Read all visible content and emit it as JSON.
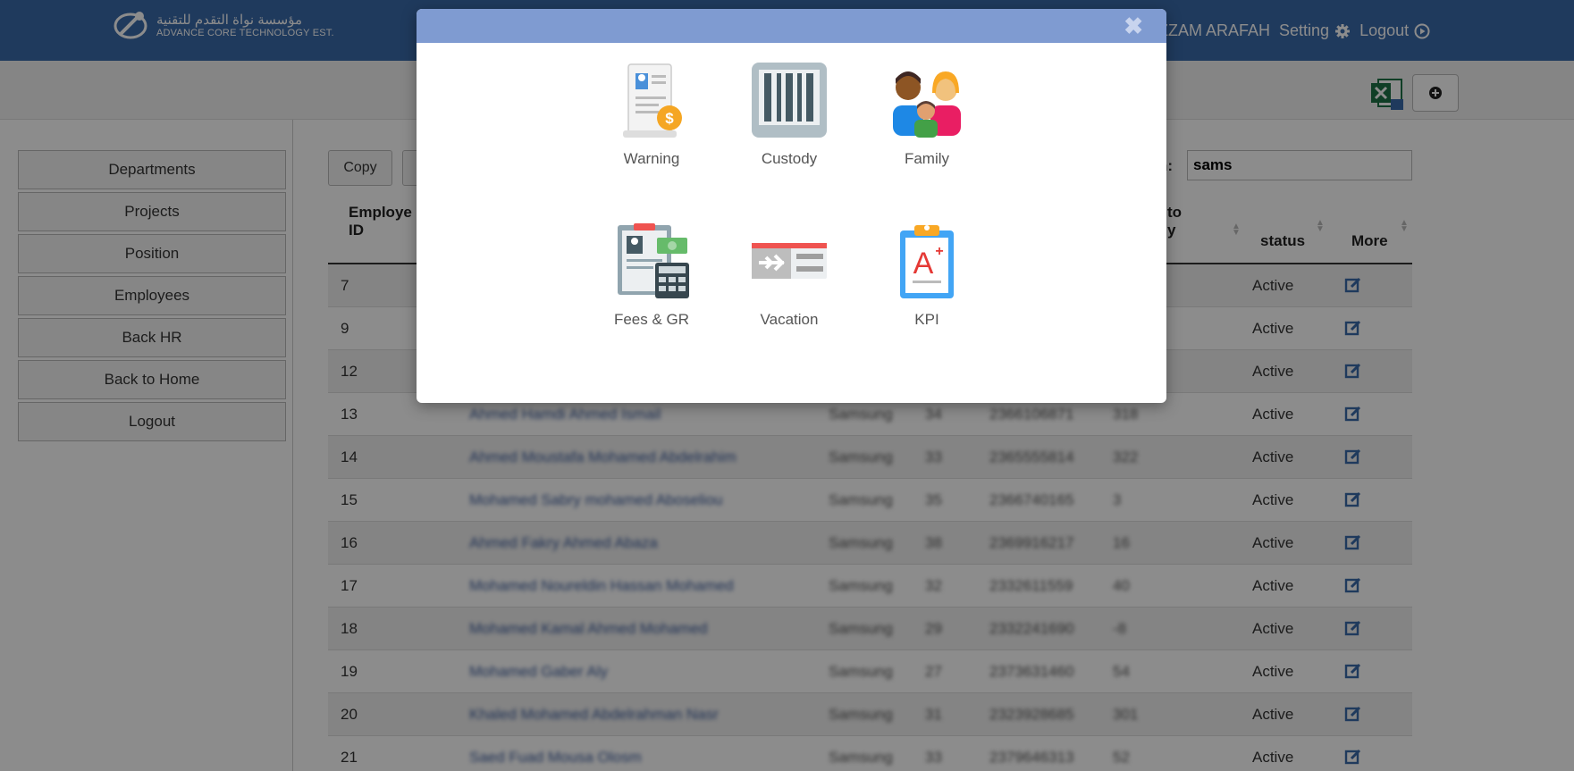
{
  "header": {
    "logo_ar": "مؤسسة نواة التقدم للتقنية",
    "logo_en": "ADVANCE CORE TECHNOLOGY EST.",
    "user_name": "ZZAM ARAFAH",
    "setting_label": "Setting",
    "logout_label": "Logout"
  },
  "sidebar": {
    "items": [
      {
        "label": "Departments"
      },
      {
        "label": "Projects"
      },
      {
        "label": "Position"
      },
      {
        "label": "Employees"
      },
      {
        "label": "Back HR"
      },
      {
        "label": "Back to Home"
      },
      {
        "label": "Logout"
      }
    ]
  },
  "table_tools": {
    "copy_label": "Copy",
    "search_label": "h:",
    "search_value": "sams"
  },
  "table": {
    "headers": {
      "employee_id_line1": "Employe",
      "employee_id_line2": "ID",
      "partial_to_line1": "to",
      "partial_to_line2": "y",
      "status": "status",
      "more": "More"
    },
    "rows": [
      {
        "id": "7",
        "name": "",
        "project": "",
        "age": "",
        "iqama": "",
        "days": "",
        "status": "Active"
      },
      {
        "id": "9",
        "name": "",
        "project": "",
        "age": "",
        "iqama": "",
        "days": "",
        "status": "Active"
      },
      {
        "id": "12",
        "name": "",
        "project": "",
        "age": "",
        "iqama": "",
        "days": "",
        "status": "Active"
      },
      {
        "id": "13",
        "name": "Ahmed Hamdi Ahmed Ismail",
        "project": "Samsung",
        "age": "34",
        "iqama": "2366106871",
        "days": "318",
        "status": "Active"
      },
      {
        "id": "14",
        "name": "Ahmed Moustafa Mohamed Abdelrahim",
        "project": "Samsung",
        "age": "33",
        "iqama": "2365555814",
        "days": "322",
        "status": "Active"
      },
      {
        "id": "15",
        "name": "Mohamed Sabry mohamed Aboseliou",
        "project": "Samsung",
        "age": "35",
        "iqama": "2366740165",
        "days": "3",
        "status": "Active"
      },
      {
        "id": "16",
        "name": "Ahmed Fakry Ahmed Abaza",
        "project": "Samsung",
        "age": "38",
        "iqama": "2369916217",
        "days": "16",
        "status": "Active"
      },
      {
        "id": "17",
        "name": "Mohamed Noureldin Hassan Mohamed",
        "project": "Samsung",
        "age": "32",
        "iqama": "2332611559",
        "days": "40",
        "status": "Active"
      },
      {
        "id": "18",
        "name": "Mohamed Kamal Ahmed Mohamed",
        "project": "Samsung",
        "age": "29",
        "iqama": "2332241690",
        "days": "-8",
        "status": "Active"
      },
      {
        "id": "19",
        "name": "Mohamed Gaber Aly",
        "project": "Samsung",
        "age": "27",
        "iqama": "2373631460",
        "days": "54",
        "status": "Active"
      },
      {
        "id": "20",
        "name": "Khaled Mohamed Abdelrahman Nasr",
        "project": "Samsung",
        "age": "31",
        "iqama": "2323928685",
        "days": "301",
        "status": "Active"
      },
      {
        "id": "21",
        "name": "Saed Fuad Mousa Olosm",
        "project": "Samsung",
        "age": "33",
        "iqama": "2379646313",
        "days": "52",
        "status": "Active"
      }
    ]
  },
  "modal": {
    "tiles": [
      {
        "label": "Warning"
      },
      {
        "label": "Custody"
      },
      {
        "label": "Family"
      },
      {
        "label": "Fees & GR"
      },
      {
        "label": "Vacation"
      },
      {
        "label": "KPI"
      }
    ]
  },
  "colors": {
    "header_bg": "#3a6aaa",
    "modal_header_bg": "#7f9bd1",
    "link_blue": "#3a5a9a",
    "edit_icon": "#3a6aaa"
  }
}
